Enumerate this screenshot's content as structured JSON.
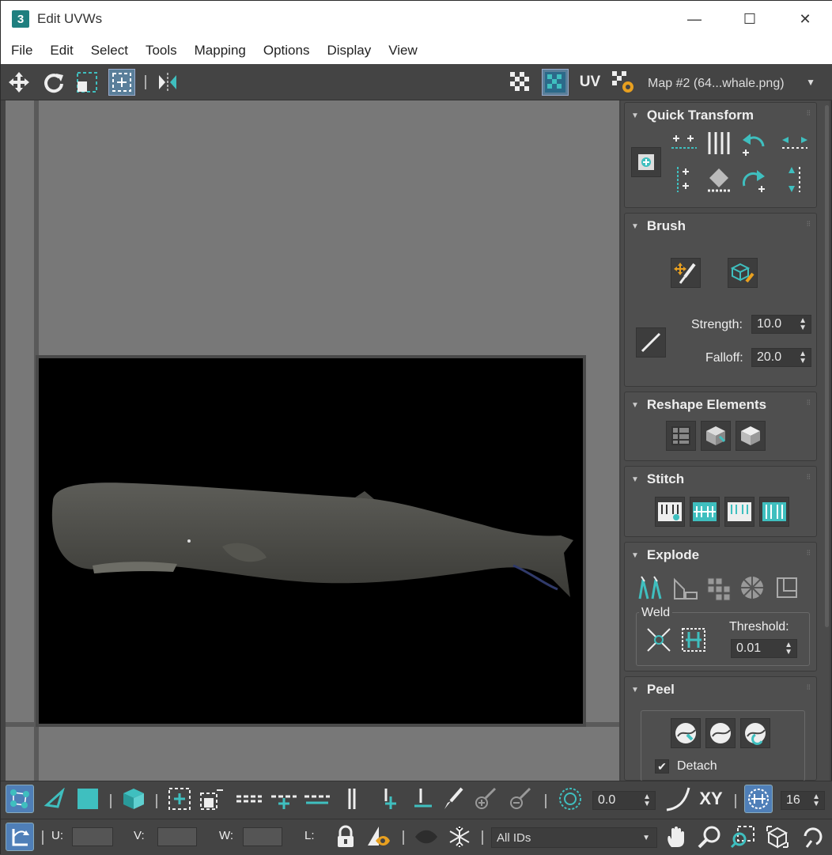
{
  "window": {
    "app_icon": "3",
    "title": "Edit UVWs",
    "minimize": "—",
    "maximize": "☐",
    "close": "✕"
  },
  "menu": [
    "File",
    "Edit",
    "Select",
    "Tools",
    "Mapping",
    "Options",
    "Display",
    "View"
  ],
  "top_toolbar": {
    "uv_label": "UV",
    "map_select": "Map #2 (64...whale.png)"
  },
  "rollouts": {
    "quick_transform": {
      "title": "Quick Transform"
    },
    "brush": {
      "title": "Brush",
      "strength_label": "Strength:",
      "strength_value": "10.0",
      "falloff_label": "Falloff:",
      "falloff_value": "20.0"
    },
    "reshape": {
      "title": "Reshape Elements"
    },
    "stitch": {
      "title": "Stitch"
    },
    "explode": {
      "title": "Explode",
      "weld_label": "Weld",
      "threshold_label": "Threshold:",
      "threshold_value": "0.01"
    },
    "peel": {
      "title": "Peel",
      "detach_label": "Detach"
    }
  },
  "bottom_toolbar": {
    "angle_value": "0.0",
    "xy_label": "XY",
    "grid_value": "16"
  },
  "status_bar": {
    "u_label": "U:",
    "v_label": "V:",
    "w_label": "W:",
    "l_label": "L:",
    "ids_select": "All IDs"
  },
  "colors": {
    "accent": "#3fbfbf",
    "panel": "#444444",
    "viewport": "#787878"
  }
}
